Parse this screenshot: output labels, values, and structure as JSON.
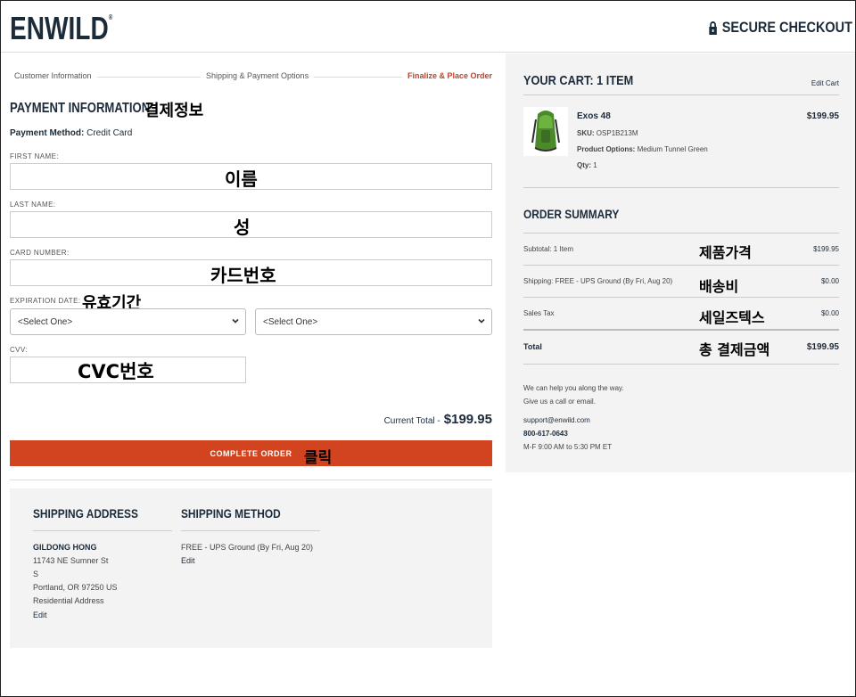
{
  "header": {
    "logo_text": "ENWILD",
    "logo_mark": "®",
    "secure_label": "SECURE CHECKOUT",
    "secure_icon": "lock-icon"
  },
  "steps": [
    {
      "label": "Customer Information",
      "active": false
    },
    {
      "label": "Shipping & Payment Options",
      "active": false
    },
    {
      "label": "Finalize & Place Order",
      "active": true
    }
  ],
  "payment": {
    "title": "PAYMENT INFORMATION",
    "title_note": "결제정보",
    "method_label": "Payment Method:",
    "method_value": "Credit Card",
    "first_name": {
      "label": "FIRST NAME:",
      "note": "이름"
    },
    "last_name": {
      "label": "LAST NAME:",
      "note": "성"
    },
    "card_number": {
      "label": "CARD NUMBER:",
      "note": "카드번호"
    },
    "expiration": {
      "label": "EXPIRATION DATE:",
      "note": "유효기간",
      "month_value": "<Select One>",
      "year_value": "<Select One>"
    },
    "cvv": {
      "label": "CVV:",
      "note": "CVC번호"
    },
    "current_total_label": "Current Total -",
    "current_total_value": "$199.95",
    "complete_button": "COMPLETE ORDER",
    "complete_note": "클릭"
  },
  "shipping": {
    "address_title": "SHIPPING ADDRESS",
    "name": "GILDONG HONG",
    "street": "11743 NE Sumner St",
    "street2": "S",
    "city": "Portland, OR 97250 US",
    "type": "Residential Address",
    "edit_address": "Edit",
    "method_title": "SHIPPING METHOD",
    "method_value": "FREE - UPS Ground (By Fri, Aug 20)",
    "edit_method": "Edit"
  },
  "cart": {
    "title": "YOUR CART: 1 ITEM",
    "edit_label": "Edit Cart",
    "item": {
      "name": "Exos 48",
      "price": "$199.95",
      "sku_label": "SKU:",
      "sku_value": "OSP1B213M",
      "options_label": "Product Options:",
      "options_value": "Medium Tunnel Green",
      "qty_label": "Qty:",
      "qty_value": "1"
    },
    "summary_title": "ORDER SUMMARY",
    "rows": [
      {
        "label": "Subtotal: 1 Item",
        "note": "제품가격",
        "value": "$199.95"
      },
      {
        "label": "Shipping: FREE - UPS Ground (By Fri, Aug 20)",
        "note": "배송비",
        "value": "$0.00"
      },
      {
        "label": "Sales Tax",
        "note": "세일즈텍스",
        "value": "$0.00"
      },
      {
        "label": "Total",
        "note": "총 결제금액",
        "value": "$199.95"
      }
    ],
    "help_line1": "We can help you along the way.",
    "help_line2": "Give us a call or email.",
    "email": "support@enwild.com",
    "phone": "800-617-0643",
    "hours": "M-F 9:00 AM to 5:30 PM ET"
  }
}
